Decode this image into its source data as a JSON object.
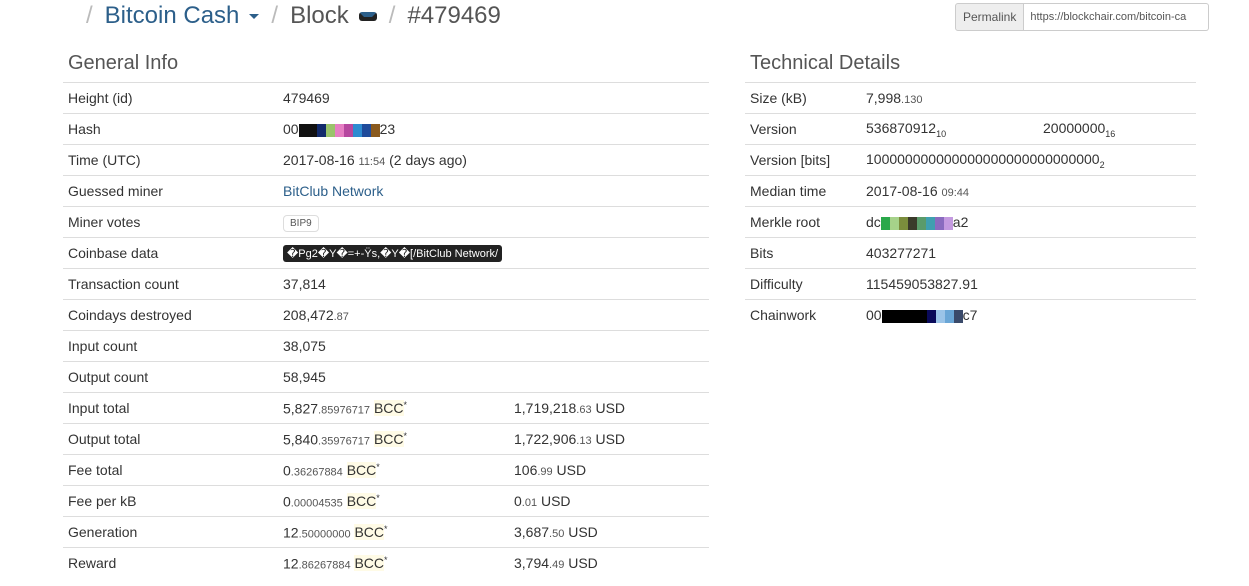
{
  "breadcrumb": {
    "coin": "Bitcoin Cash",
    "section": "Block",
    "id": "#479469"
  },
  "permalink": {
    "label": "Permalink",
    "url": "https://blockchair.com/bitcoin-ca"
  },
  "general": {
    "title": "General Info",
    "height": {
      "label": "Height (id)",
      "value": "479469"
    },
    "hash": {
      "label": "Hash",
      "prefix": "00",
      "suffix": "23",
      "colors": [
        "#111",
        "#111",
        "#122a6b",
        "#9ac36b",
        "#e67ec3",
        "#b6479f",
        "#2d8bd0",
        "#1f4b9b",
        "#8a5a1e"
      ]
    },
    "time": {
      "label": "Time (UTC)",
      "date": "2017-08-16",
      "time": "11:54",
      "ago": "(2 days ago)"
    },
    "miner": {
      "label": "Guessed miner",
      "value": "BitClub Network"
    },
    "votes": {
      "label": "Miner votes",
      "value": "BIP9"
    },
    "coinbase": {
      "label": "Coinbase data",
      "value": "�Pg2�Y�=+-Ÿs,�Y�[/BitClub Network/"
    },
    "tx_count": {
      "label": "Transaction count",
      "value": "37,814"
    },
    "coindays": {
      "label": "Coindays destroyed",
      "int": "208,472",
      "frac": ".87"
    },
    "input_count": {
      "label": "Input count",
      "value": "38,075"
    },
    "output_count": {
      "label": "Output count",
      "value": "58,945"
    },
    "input_total": {
      "label": "Input total",
      "int": "5,827",
      "frac": ".85976717",
      "unit": "BCC",
      "usd_int": "1,719,218",
      "usd_frac": ".63",
      "usd_unit": "USD"
    },
    "output_total": {
      "label": "Output total",
      "int": "5,840",
      "frac": ".35976717",
      "unit": "BCC",
      "usd_int": "1,722,906",
      "usd_frac": ".13",
      "usd_unit": "USD"
    },
    "fee_total": {
      "label": "Fee total",
      "int": "0",
      "frac": ".36267884",
      "unit": "BCC",
      "usd_int": "106",
      "usd_frac": ".99",
      "usd_unit": "USD"
    },
    "fee_kb": {
      "label": "Fee per kB",
      "int": "0",
      "frac": ".00004535",
      "unit": "BCC",
      "usd_int": "0",
      "usd_frac": ".01",
      "usd_unit": "USD"
    },
    "generation": {
      "label": "Generation",
      "int": "12",
      "frac": ".50000000",
      "unit": "BCC",
      "usd_int": "3,687",
      "usd_frac": ".50",
      "usd_unit": "USD"
    },
    "reward": {
      "label": "Reward",
      "int": "12",
      "frac": ".86267884",
      "unit": "BCC",
      "usd_int": "3,794",
      "usd_frac": ".49",
      "usd_unit": "USD"
    }
  },
  "technical": {
    "title": "Technical Details",
    "size": {
      "label": "Size (kB)",
      "int": "7,998",
      "frac": ".130"
    },
    "version": {
      "label": "Version",
      "dec": "536870912",
      "dec_base": "10",
      "hex": "20000000",
      "hex_base": "16"
    },
    "version_bits": {
      "label": "Version [bits]",
      "value": "100000000000000000000000000000",
      "base": "2"
    },
    "median": {
      "label": "Median time",
      "date": "2017-08-16",
      "time": "09:44"
    },
    "merkle": {
      "label": "Merkle root",
      "prefix": "dc",
      "suffix": "a2",
      "colors": [
        "#2aa84a",
        "#a6d28a",
        "#7b8d3c",
        "#3a3a2a",
        "#5a9b6a",
        "#3f9fb0",
        "#8a6bbf",
        "#c49ae0"
      ]
    },
    "bits": {
      "label": "Bits",
      "value": "403277271"
    },
    "difficulty": {
      "label": "Difficulty",
      "value": "115459053827.91"
    },
    "chainwork": {
      "label": "Chainwork",
      "prefix": "00",
      "suffix": "c7",
      "colors": [
        "#000",
        "#000",
        "#000",
        "#000",
        "#000",
        "#0a0a5a",
        "#9bc4e8",
        "#6aa6d6",
        "#3a4a6a"
      ]
    }
  }
}
